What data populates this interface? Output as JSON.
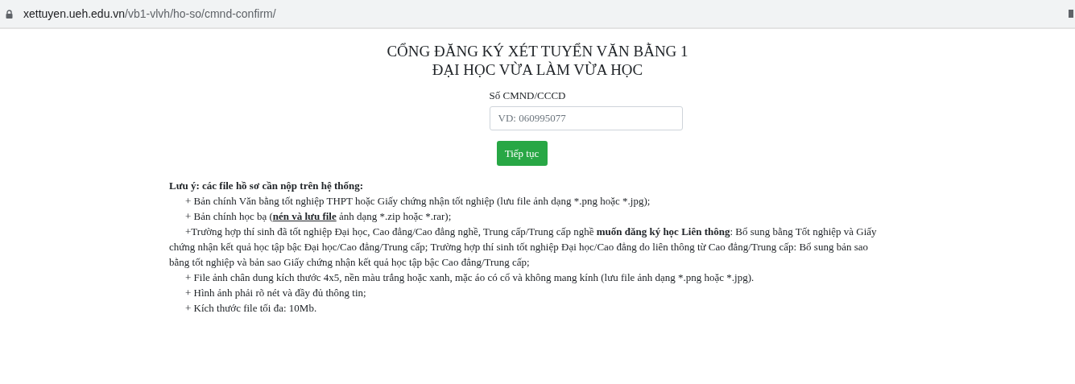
{
  "address_bar": {
    "domain": "xettuyen.ueh.edu.vn",
    "path": "/vb1-vlvh/ho-so/cmnd-confirm/"
  },
  "title_lines": [
    "CỔNG ĐĂNG KÝ XÉT TUYỂN VĂN BẰNG 1",
    "ĐẠI HỌC VỪA LÀM VỪA HỌC"
  ],
  "form": {
    "label": "Số CMND/CCCD",
    "placeholder": "VD: 060995077",
    "button": "Tiếp tục"
  },
  "note": {
    "heading": "Lưu ý: các file hồ sơ cần nộp trên hệ thống:",
    "items": [
      {
        "parts": [
          {
            "text": "+ Bản chính Văn bằng tốt nghiệp THPT hoặc Giấy chứng nhận tốt nghiệp (lưu file ảnh dạng *.png hoặc *.jpg);"
          }
        ]
      },
      {
        "parts": [
          {
            "text": "+ Bản chính học bạ ("
          },
          {
            "text": "nén và lưu file",
            "kind": "underlined"
          },
          {
            "text": " ảnh dạng *.zip hoặc *.rar);"
          }
        ]
      },
      {
        "parts": [
          {
            "text": "+Trường hợp thí sinh đã tốt nghiệp Đại học, Cao đẳng/Cao đẳng nghề, Trung cấp/Trung cấp nghề "
          },
          {
            "text": "muốn đăng ký học Liên thông",
            "kind": "strong"
          },
          {
            "text": ": Bổ sung bằng Tốt nghiệp và Giấy chứng nhận kết quả học tập bậc Đại học/Cao đẳng/Trung cấp; Trường hợp thí sinh tốt nghiệp Đại học/Cao đẳng do liên thông từ Cao đẳng/Trung cấp: Bổ sung bản sao bằng tốt nghiệp và bản sao Giấy chứng nhận kết quả học tập bậc Cao đẳng/Trung cấp;"
          }
        ]
      },
      {
        "parts": [
          {
            "text": "+ File ảnh chân dung kích thước 4x5, nền màu trắng hoặc xanh, mặc áo có cổ và không mang kính (lưu file ảnh dạng *.png hoặc *.jpg)."
          }
        ]
      },
      {
        "parts": [
          {
            "text": "+ Hình ảnh phải rõ nét và đầy đủ thông tin;"
          }
        ]
      },
      {
        "parts": [
          {
            "text": "+ Kích thước file tối đa: 10Mb."
          }
        ]
      }
    ]
  }
}
